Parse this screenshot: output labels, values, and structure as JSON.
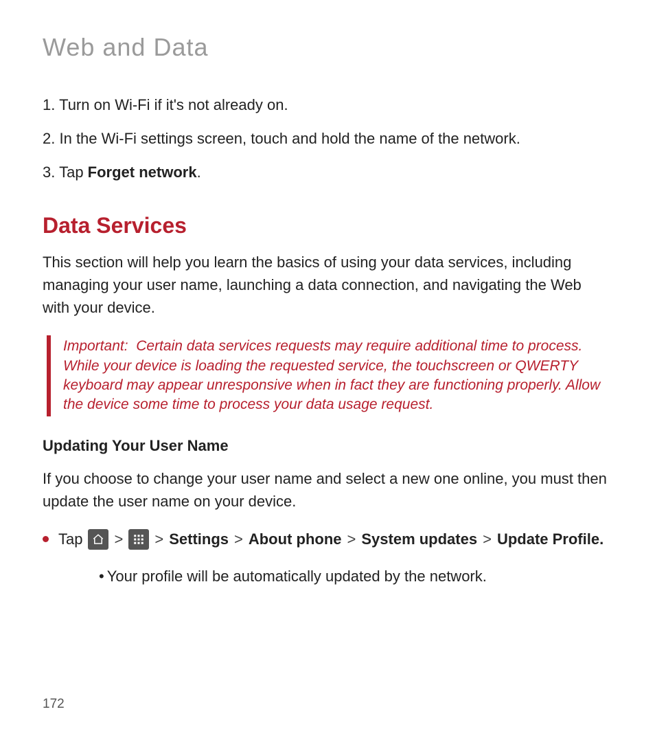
{
  "page_title": "Web and Data",
  "steps": [
    {
      "num": "1.",
      "text": "Turn on Wi-Fi if it's not already on."
    },
    {
      "num": "2.",
      "text": "In the Wi-Fi settings screen, touch and hold the name of the network."
    },
    {
      "num": "3.",
      "text_pre": "Tap ",
      "bold": "Forget network",
      "text_post": "."
    }
  ],
  "section_heading": "Data Services",
  "section_body": "This section will help you learn the basics of using your data services, including managing your user name, launching a data connection, and navigating the Web with your device.",
  "callout": {
    "lead": "Important:",
    "body": "Certain data services requests may require additional time to process. While your device is loading the requested service, the touchscreen or QWERTY keyboard may appear unresponsive when in fact they are functioning properly. Allow the device some time to process your data usage request."
  },
  "subheading": "Updating Your User Name",
  "sub_body": "If you choose to change your user name and select a a new one online, you must then update the user name on your device.",
  "sub_body_actual": "If you choose to change your user name and select a new one online, you must then update the user name on your device.",
  "tap_line": {
    "tap": "Tap",
    "sep": ">",
    "settings": "Settings",
    "about": "About phone",
    "updates": "System updates",
    "profile": "Update Profile."
  },
  "sub_bullet": "Your profile will be automatically updated by the network.",
  "page_number": "172"
}
